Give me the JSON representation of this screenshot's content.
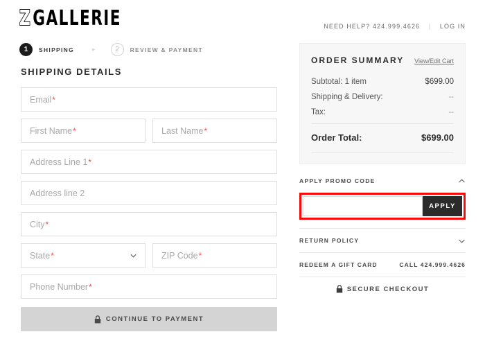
{
  "header": {
    "logo_z": "Z",
    "logo_rest": "GALLERIE",
    "need_help": "NEED HELP? 424.999.4626",
    "separator": "|",
    "login": "LOG IN"
  },
  "steps": [
    {
      "number": "1",
      "label": "SHIPPING",
      "state": "active"
    },
    {
      "number": "2",
      "label": "REVIEW & PAYMENT",
      "state": "inactive"
    }
  ],
  "step_arrow": "▸",
  "shipping": {
    "title": "SHIPPING DETAILS",
    "fields": [
      {
        "name": "email",
        "placeholder": "Email",
        "required": true,
        "value": ""
      },
      {
        "name": "first-name",
        "placeholder": "First Name",
        "required": true,
        "value": ""
      },
      {
        "name": "last-name",
        "placeholder": "Last Name",
        "required": true,
        "value": ""
      },
      {
        "name": "address-line-1",
        "placeholder": "Address Line 1",
        "required": true,
        "value": ""
      },
      {
        "name": "address-line-2",
        "placeholder": "Address line 2",
        "required": false,
        "value": ""
      },
      {
        "name": "city",
        "placeholder": "City",
        "required": true,
        "value": ""
      },
      {
        "name": "state",
        "placeholder": "State",
        "required": true,
        "value": ""
      },
      {
        "name": "zip-code",
        "placeholder": "ZIP Code",
        "required": true,
        "value": ""
      },
      {
        "name": "phone-number",
        "placeholder": "Phone Number",
        "required": true,
        "value": ""
      }
    ],
    "required_marker": "*",
    "continue_button": "CONTINUE TO PAYMENT"
  },
  "order_summary": {
    "title": "ORDER SUMMARY",
    "edit_link": "View/Edit Cart",
    "rows": [
      {
        "label": "Subtotal: 1 item",
        "value": "$699.00"
      },
      {
        "label": "Shipping & Delivery:",
        "value": "--"
      },
      {
        "label": "Tax:",
        "value": "--"
      }
    ],
    "total_label": "Order Total:",
    "total_value": "$699.00"
  },
  "promo": {
    "heading": "APPLY PROMO CODE",
    "input_value": "",
    "input_placeholder": "",
    "apply_button": "APPLY",
    "highlight_color": "#fb0808",
    "expanded": true
  },
  "return_policy": {
    "heading": "RETURN POLICY",
    "expanded": false
  },
  "gift_card": {
    "label": "REDEEM A GIFT CARD",
    "call": "CALL 424.999.4626"
  },
  "secure": {
    "label": "SECURE CHECKOUT"
  },
  "colors": {
    "accent_dark": "#2b2b2b",
    "required_red": "#ef4a4a",
    "highlight_red": "#fb0808",
    "summary_bg": "#f7f7f7",
    "disabled_button": "#d4d4d4"
  }
}
